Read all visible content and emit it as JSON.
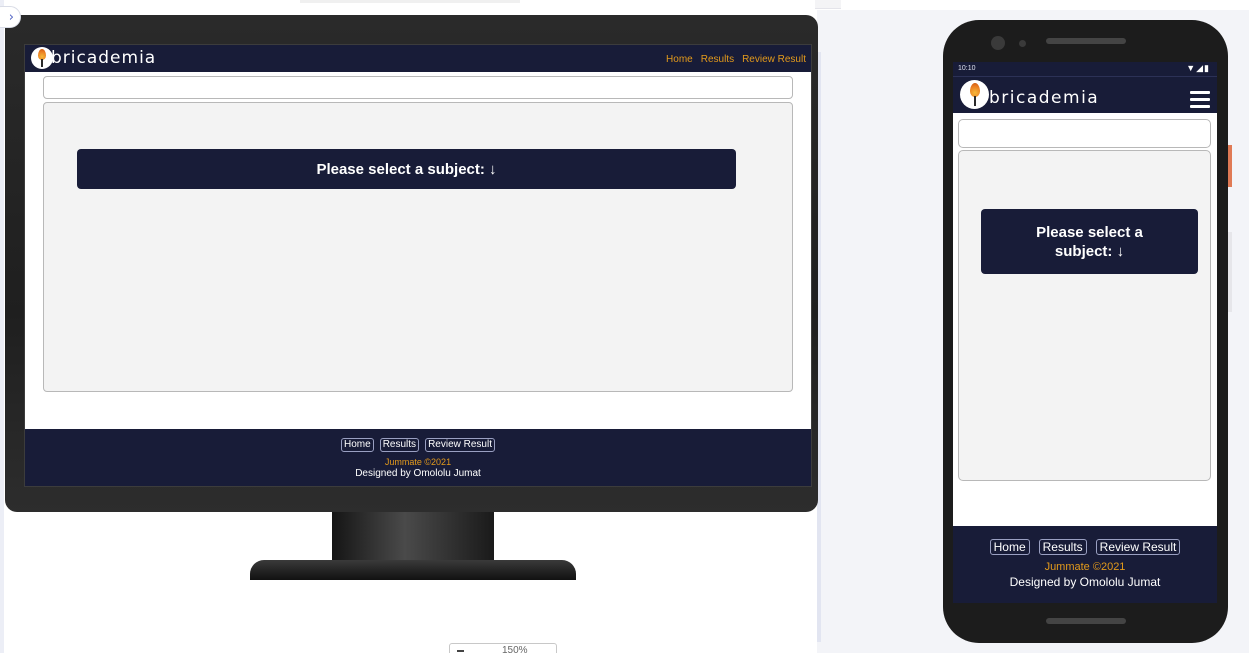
{
  "site": {
    "brand": "bricademia",
    "nav_links": [
      "Home",
      "Results",
      "Review Result"
    ],
    "prompt": "Please select a subject: ↓",
    "footer_links": [
      "Home",
      "Results",
      "Review Result"
    ],
    "copyright": "Jummate ©2021",
    "credit": "Designed by Omololu Jumat"
  },
  "phone": {
    "status_time": "10:10",
    "status_icons": "▼◢▮"
  },
  "editor": {
    "expand_icon": "chevron-right-icon",
    "zoom_value": "150%"
  },
  "colors": {
    "navy": "#181c38",
    "accent_orange": "#e39a1b"
  }
}
